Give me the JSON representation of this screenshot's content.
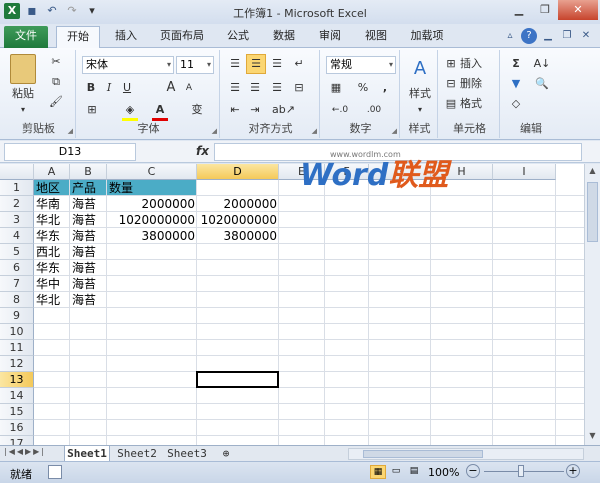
{
  "window": {
    "title": "工作簿1 - Microsoft Excel"
  },
  "qat": {
    "app": "X",
    "save": "▪",
    "undo": "↶",
    "redo": "↷",
    "more": "▾"
  },
  "controls": {
    "minimize": "▁",
    "restore": "❐",
    "close": "✕"
  },
  "tabs": [
    "文件",
    "开始",
    "插入",
    "页面布局",
    "公式",
    "数据",
    "审阅",
    "视图",
    "加载项"
  ],
  "ribbon": {
    "clipboard": {
      "label": "剪贴板",
      "paste": "粘贴"
    },
    "font": {
      "label": "字体",
      "name": "宋体",
      "size": "11",
      "bold": "B",
      "italic": "I",
      "underline": "U",
      "grow": "A",
      "shrink": "A",
      "fill_color": "#ffff00",
      "font_color": "#e00000"
    },
    "alignment": {
      "label": "对齐方式"
    },
    "number": {
      "label": "数字",
      "format": "常规",
      "percent": "%",
      "comma": ",",
      "inc": "←.0",
      "dec": ".00"
    },
    "styles": {
      "label": "样式",
      "button": "样式"
    },
    "cells": {
      "label": "单元格",
      "insert": "插入",
      "delete": "删除",
      "format": "格式"
    },
    "editing": {
      "label": "编辑",
      "sum": "Σ"
    }
  },
  "formula_bar": {
    "name_box": "D13",
    "fx": "fx",
    "value": ""
  },
  "grid": {
    "columns": [
      "A",
      "B",
      "C",
      "D",
      "E",
      "F",
      "G",
      "H",
      "I"
    ],
    "rows": [
      "1",
      "2",
      "3",
      "4",
      "5",
      "6",
      "7",
      "8",
      "9",
      "10",
      "11",
      "12",
      "13",
      "14",
      "15",
      "16",
      "17"
    ],
    "cells": {
      "A1": "地区",
      "B1": "产品",
      "C1": "数量",
      "A2": "华南",
      "B2": "海苔",
      "C2": "2000000",
      "D2": "2000000",
      "A3": "华北",
      "B3": "海苔",
      "C3": "1020000000",
      "D3": "1020000000",
      "A4": "华东",
      "B4": "海苔",
      "C4": "3800000",
      "D4": "3800000",
      "A5": "西北",
      "B5": "海苔",
      "A6": "华东",
      "B6": "海苔",
      "A7": "华中",
      "B7": "海苔",
      "A8": "华北",
      "B8": "海苔"
    },
    "header_fill": "#4bacc6",
    "active_cell": "D13"
  },
  "sheets": [
    "Sheet1",
    "Sheet2",
    "Sheet3"
  ],
  "status": {
    "ready": "就绪",
    "zoom": "100%",
    "minus": "−",
    "plus": "+"
  },
  "watermark": {
    "word": "Word",
    "cn": "联盟",
    "url": "www.wordlm.com"
  }
}
